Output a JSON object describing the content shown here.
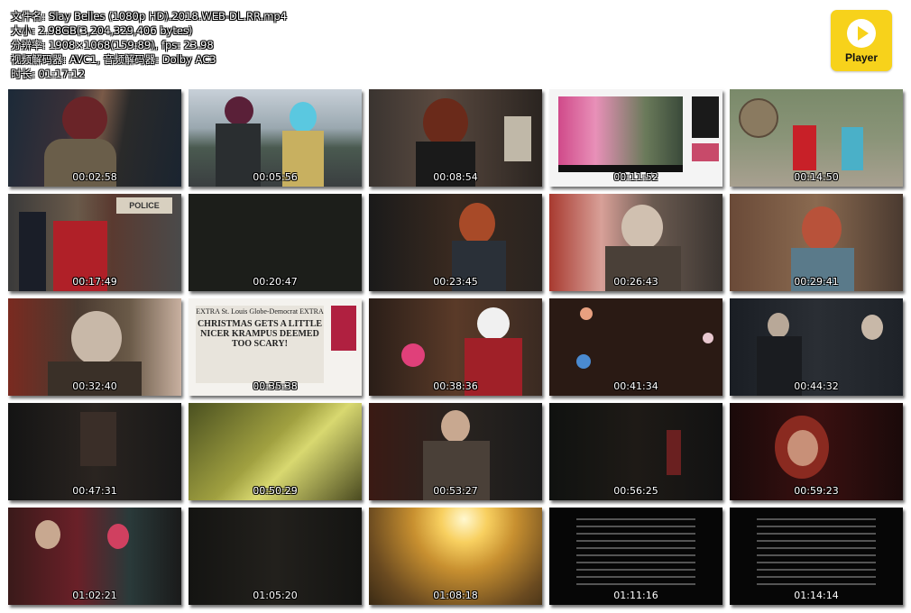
{
  "file_info": {
    "filename": "文件名: Slay Belles (1080p HD).2018.WEB-DL.RR.mp4",
    "size": "大小: 2.98GB(3,204,329,406 bytes)",
    "resolution": "分辨率: 1908×1068(159:89), fps: 23.98",
    "codecs": "视频解码器: AVC1, 音频解码器: Dolby AC3",
    "duration": "时长: 01:17:12"
  },
  "logo": {
    "label": "Player",
    "icon": "play-icon",
    "color": "#f7d21b"
  },
  "thumbnails": [
    {
      "time": "00:02:58"
    },
    {
      "time": "00:05:56"
    },
    {
      "time": "00:08:54"
    },
    {
      "time": "00:11:52"
    },
    {
      "time": "00:14:50"
    },
    {
      "time": "00:17:49"
    },
    {
      "time": "00:20:47"
    },
    {
      "time": "00:23:45"
    },
    {
      "time": "00:26:43"
    },
    {
      "time": "00:29:41"
    },
    {
      "time": "00:32:40"
    },
    {
      "time": "00:35:38"
    },
    {
      "time": "00:38:36"
    },
    {
      "time": "00:41:34"
    },
    {
      "time": "00:44:32"
    },
    {
      "time": "00:47:31"
    },
    {
      "time": "00:50:29"
    },
    {
      "time": "00:53:27"
    },
    {
      "time": "00:56:25"
    },
    {
      "time": "00:59:23"
    },
    {
      "time": "01:02:21"
    },
    {
      "time": "01:05:20"
    },
    {
      "time": "01:08:18"
    },
    {
      "time": "01:11:16"
    },
    {
      "time": "01:14:14"
    }
  ],
  "newspaper": {
    "masthead": "EXTRA St. Louis Globe-Democrat EXTRA",
    "headline": "CHRISTMAS GETS A LITTLE NICER KRAMPUS DEEMED TOO SCARY!"
  },
  "police_sign": "POLICE"
}
